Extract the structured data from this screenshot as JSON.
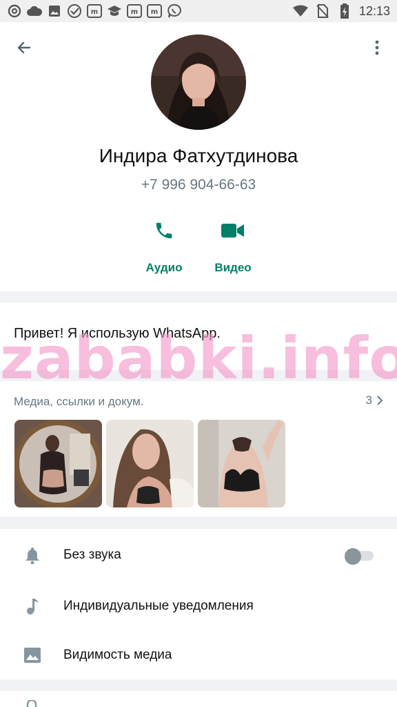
{
  "status_bar": {
    "time": "12:13",
    "left_icons": [
      "at-icon",
      "cloud-icon",
      "gallery-icon",
      "check-circle-icon",
      "messenger-m-icon",
      "graduation-cap-icon",
      "messenger-m-icon",
      "messenger-m-icon",
      "viber-icon"
    ],
    "right_icons": [
      "wifi-icon",
      "no-sim-icon",
      "battery-charging-icon"
    ]
  },
  "contact": {
    "name": "Индира Фатхутдинова",
    "phone": "+7 996 904-66-63"
  },
  "actions": {
    "audio_label": "Аудио",
    "video_label": "Видео"
  },
  "about": {
    "text": "Привет! Я использую WhatsApp."
  },
  "media": {
    "title": "Медиа, ссылки и докум.",
    "count": "3"
  },
  "settings": {
    "items": [
      {
        "label": "Без звука",
        "icon": "bell-icon",
        "toggle": false
      },
      {
        "label": "Индивидуальные уведомления",
        "icon": "music-note-icon"
      },
      {
        "label": "Видимость медиа",
        "icon": "image-icon"
      }
    ]
  },
  "watermark": "zababki.info",
  "colors": {
    "accent": "#008069",
    "secondary_text": "#667781",
    "background": "#f0f2f5"
  }
}
